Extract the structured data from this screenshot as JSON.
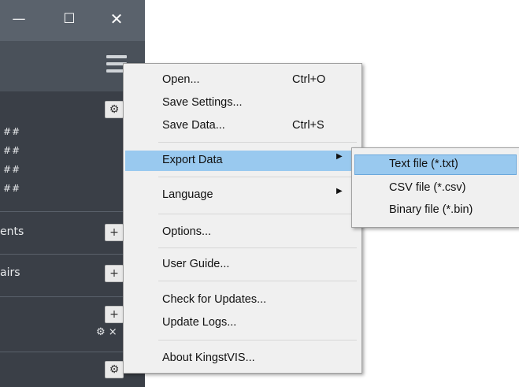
{
  "window": {
    "minimize_glyph": "—",
    "maximize_glyph": "☐",
    "close_glyph": "✕",
    "menu_icon": "hamburger-icon"
  },
  "sidebar": {
    "hash_rows": [
      "##",
      "##",
      "##",
      "##"
    ],
    "sections": [
      {
        "label": "ents",
        "button": "+"
      },
      {
        "label": "airs",
        "button": "+"
      }
    ],
    "add_glyph": "+",
    "gear_glyph": "⚙",
    "gear_close_text": "⚙ ×"
  },
  "menu": {
    "items": [
      {
        "label": "Open...",
        "shortcut": "Ctrl+O"
      },
      {
        "label": "Save Settings...",
        "shortcut": ""
      },
      {
        "label": "Save Data...",
        "shortcut": "Ctrl+S"
      },
      {
        "label": "Export Data",
        "shortcut": "",
        "submenu": true,
        "highlighted": true
      },
      {
        "label": "Language",
        "shortcut": "",
        "submenu": true
      },
      {
        "label": "Options...",
        "shortcut": ""
      },
      {
        "label": "User Guide...",
        "shortcut": ""
      },
      {
        "label": "Check for Updates...",
        "shortcut": ""
      },
      {
        "label": "Update Logs...",
        "shortcut": ""
      },
      {
        "label": "About KingstVIS...",
        "shortcut": ""
      }
    ],
    "arrow_glyph": "▶"
  },
  "submenu": {
    "items": [
      {
        "label": "Text file (*.txt)",
        "highlighted": true
      },
      {
        "label": "CSV file (*.csv)"
      },
      {
        "label": "Binary file (*.bin)"
      }
    ]
  },
  "colors": {
    "highlight": "#99c9ef",
    "menu_bg": "#f0f0f0",
    "app_bg": "#3a3f47"
  }
}
